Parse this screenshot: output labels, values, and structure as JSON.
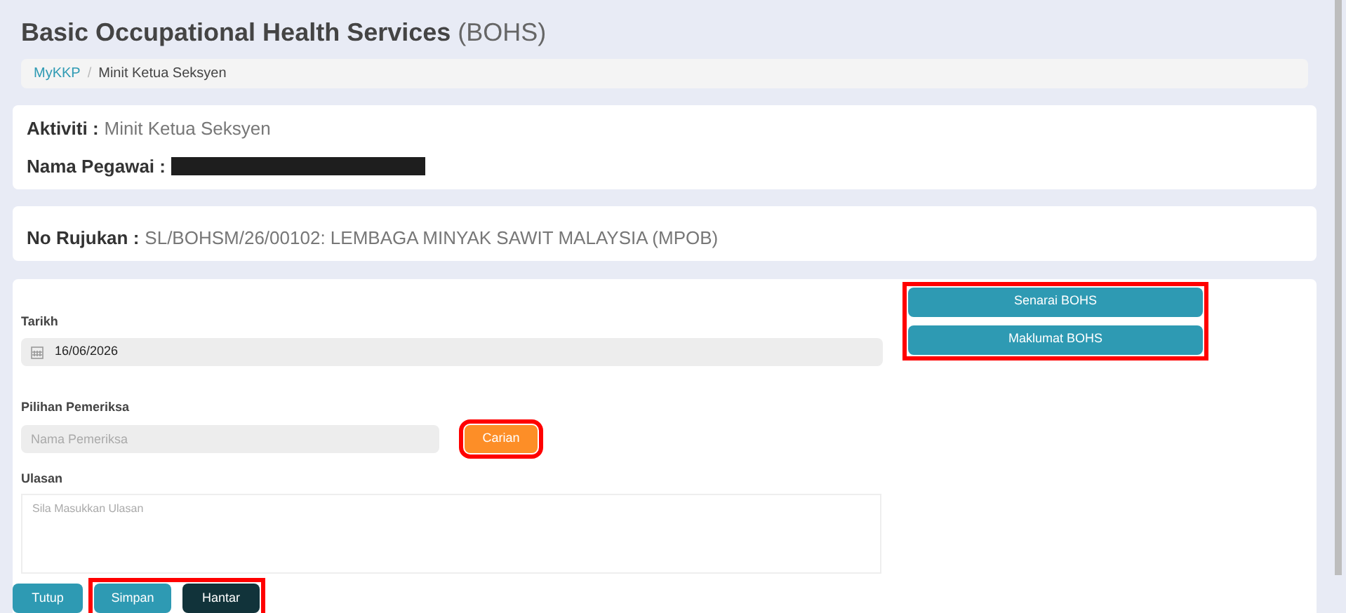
{
  "page_title": {
    "main": "Basic Occupational Health Services",
    "suffix": "(BOHS)"
  },
  "breadcrumb": [
    {
      "label": "MyKKP",
      "kind": "link"
    },
    {
      "label": "/",
      "kind": "separator"
    },
    {
      "label": "Minit Ketua Seksyen",
      "kind": "current"
    }
  ],
  "info_card": {
    "fields": [
      {
        "label": "Aktiviti :",
        "value": "Minit Ketua Seksyen",
        "redacted": false
      },
      {
        "label": "Nama Pegawai :",
        "redacted": true
      }
    ]
  },
  "reference_card": {
    "label": "No Rujukan :",
    "value": "SL/BOHSM/26/00102: LEMBAGA MINYAK SAWIT MALAYSIA (MPOB)"
  },
  "form": {
    "date": {
      "label": "Tarikh",
      "value": "16/06/2026"
    },
    "examiner": {
      "label": "Pilihan Pemeriksa",
      "placeholder": "Nama Pemeriksa",
      "search_button": "Carian",
      "highlighted": true
    },
    "remarks": {
      "label": "Ulasan",
      "placeholder": "Sila Masukkan Ulasan"
    },
    "side_buttons": {
      "highlighted": true,
      "items": [
        "Senarai BOHS",
        "Maklumat BOHS"
      ]
    },
    "footer": {
      "close_button": "Tutup",
      "action_group": {
        "highlighted": true,
        "items": [
          {
            "label": "Simpan",
            "kind": "save"
          },
          {
            "label": "Hantar",
            "kind": "submit"
          }
        ]
      }
    }
  }
}
